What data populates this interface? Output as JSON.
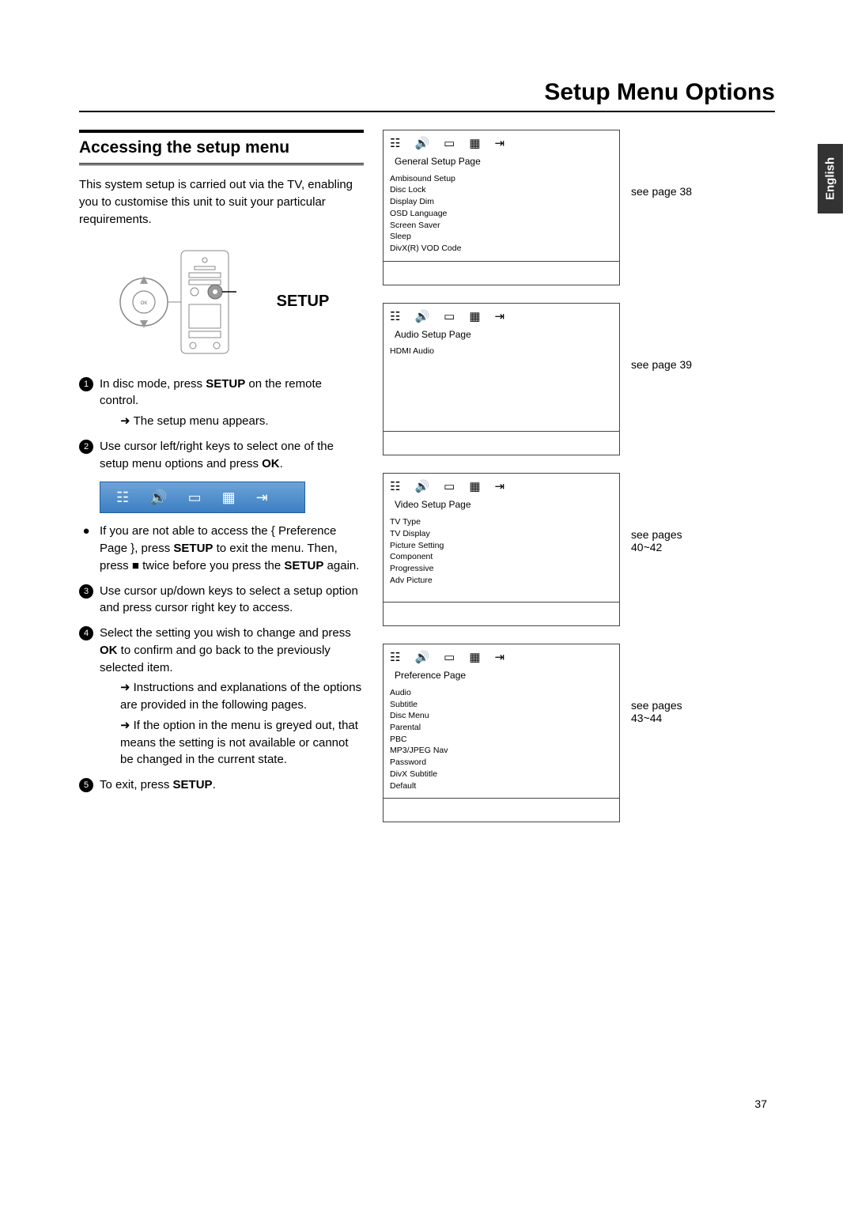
{
  "pageTitle": "Setup Menu Options",
  "languageTab": "English",
  "pageNumber": "37",
  "section": {
    "title": "Accessing the setup menu",
    "intro": "This system setup is carried out via the TV, enabling you to customise this unit to suit your particular requirements.",
    "setupLabel": "SETUP",
    "steps": {
      "s1_a": "In disc mode, press ",
      "s1_b": "SETUP",
      "s1_c": " on the remote control.",
      "s1_sub": "The setup menu appears.",
      "s2_a": "Use cursor left/right keys to select one of the setup menu options and press ",
      "s2_b": "OK",
      "s2_c": ".",
      "note_a": "If you are not able to access the { Preference Page }, press ",
      "note_b": "SETUP",
      "note_c": " to exit the menu.  Then, press ",
      "note_d": "■",
      "note_e": " twice before you press the ",
      "note_f": "SETUP",
      "note_g": " again.",
      "s3": "Use cursor up/down keys to select a setup option and press cursor right key to access.",
      "s4_a": "Select the setting you wish to change and press ",
      "s4_b": "OK",
      "s4_c": " to confirm and go back to the previously selected item.",
      "s4_sub1": "Instructions and explanations of the options are provided in the following pages.",
      "s4_sub2": "If the option in the menu is greyed out, that means the setting is not available or cannot be changed in the current state.",
      "s5_a": "To exit, press ",
      "s5_b": "SETUP",
      "s5_c": "."
    }
  },
  "panels": [
    {
      "title": "General Setup Page",
      "items": [
        "Ambisound Setup",
        "Disc Lock",
        "Display Dim",
        "OSD Language",
        "Screen Saver",
        "Sleep",
        "DivX(R) VOD Code"
      ],
      "ref": "see page 38"
    },
    {
      "title": "Audio Setup Page",
      "items": [
        "HDMI Audio"
      ],
      "ref": "see page 39"
    },
    {
      "title": "Video Setup Page",
      "items": [
        "TV Type",
        "TV Display",
        "Picture Setting",
        "Component",
        "Progressive",
        "Adv Picture"
      ],
      "ref": "see pages 40~42"
    },
    {
      "title": "Preference Page",
      "items": [
        "Audio",
        "Subtitle",
        "Disc Menu",
        "Parental",
        "PBC",
        "MP3/JPEG Nav",
        "Password",
        "DivX Subtitle",
        "Default"
      ],
      "ref": "see pages 43~44"
    }
  ],
  "iconNames": [
    "sliders-icon",
    "speaker-icon",
    "screen-icon",
    "grid-icon",
    "goto-icon"
  ]
}
